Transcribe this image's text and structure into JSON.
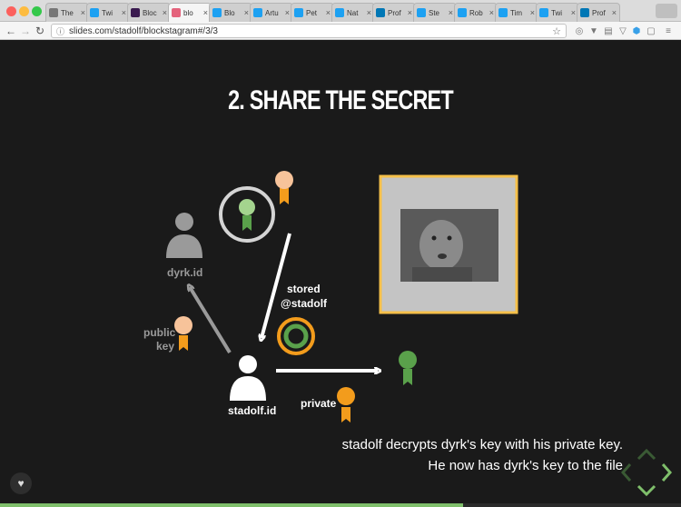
{
  "browser": {
    "tabs": [
      {
        "title": "The",
        "icon": "bookmark-icon",
        "color": "#777777"
      },
      {
        "title": "Twi",
        "icon": "twitter-icon",
        "color": "#1da1f2"
      },
      {
        "title": "Bloc",
        "icon": "blockstack-icon",
        "color": "#3a1a4f"
      },
      {
        "title": "blo",
        "icon": "slides-icon",
        "color": "#e4637c",
        "active": true
      },
      {
        "title": "Blo",
        "icon": "twitter-icon",
        "color": "#1da1f2"
      },
      {
        "title": "Artu",
        "icon": "twitter-icon",
        "color": "#1da1f2"
      },
      {
        "title": "Pet",
        "icon": "twitter-icon",
        "color": "#1da1f2"
      },
      {
        "title": "Nat",
        "icon": "twitter-icon",
        "color": "#1da1f2"
      },
      {
        "title": "Prof",
        "icon": "linkedin-icon",
        "color": "#0077b5"
      },
      {
        "title": "Ste",
        "icon": "twitter-icon",
        "color": "#1da1f2"
      },
      {
        "title": "Rob",
        "icon": "twitter-icon",
        "color": "#1da1f2"
      },
      {
        "title": "Tim",
        "icon": "twitter-icon",
        "color": "#1da1f2"
      },
      {
        "title": "Twi",
        "icon": "twitter-icon",
        "color": "#1da1f2"
      },
      {
        "title": "Prof",
        "icon": "linkedin-icon",
        "color": "#0077b5"
      }
    ],
    "url": "slides.com/stadolf/blockstagram#/3/3"
  },
  "slide": {
    "title": "2. SHARE THE SECRET",
    "labels": {
      "dyrk": "dyrk.id",
      "stored_line1": "stored",
      "stored_line2": "@stadolf",
      "public_line1": "public",
      "public_line2": "key",
      "stadolf": "stadolf.id",
      "private": "private"
    },
    "caption_line1": "stadolf decrypts dyrk's key with his private key.",
    "caption_line2": "He now has dyrk's key to the file",
    "progress": 0.68,
    "colors": {
      "peach": "#f7c39a",
      "green": "#5aa14b",
      "orange": "#f39c1c",
      "gray": "#9a9a9a",
      "frame": "#f5c04a"
    }
  }
}
